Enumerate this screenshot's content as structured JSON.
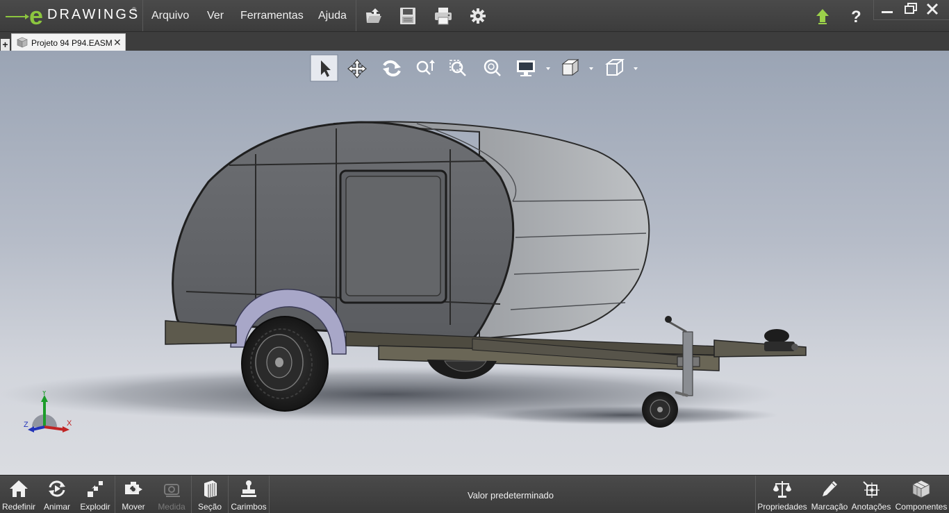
{
  "app": {
    "logo_text": "DRAWINGS",
    "logo_reg": "®"
  },
  "menu": {
    "items": [
      "Arquivo",
      "Ver",
      "Ferramentas",
      "Ajuda"
    ]
  },
  "toolbar": {
    "icons": [
      "open-folder-icon",
      "save-icon",
      "print-icon",
      "settings-gear-icon"
    ]
  },
  "titlebar": {
    "icons": [
      "update-arrow-icon",
      "help-icon",
      "minimize-icon",
      "restore-icon",
      "close-icon"
    ]
  },
  "tabs": {
    "new_tab": "+",
    "active": {
      "label": "Projeto 94 P94.EASM",
      "close": "✕"
    }
  },
  "view_toolbar": {
    "icons": [
      "select-arrow-icon",
      "pan-icon",
      "rotate-icon",
      "zoom-fit-icon",
      "zoom-area-icon",
      "zoom-icon",
      "display-style-icon",
      "view-orientation-icon",
      "cube-view-icon"
    ]
  },
  "triad": {
    "x": "X",
    "y": "Y",
    "z": "Z"
  },
  "bottom": {
    "left_buttons": [
      {
        "label": "Redefinir",
        "icon": "home-icon",
        "enabled": true
      },
      {
        "label": "Animar",
        "icon": "animate-icon",
        "enabled": true
      },
      {
        "label": "Explodir",
        "icon": "explode-icon",
        "enabled": true
      },
      {
        "label": "Mover",
        "icon": "move-icon",
        "enabled": true
      },
      {
        "label": "Medida",
        "icon": "measure-icon",
        "enabled": false
      },
      {
        "label": "Seção",
        "icon": "section-icon",
        "enabled": true
      },
      {
        "label": "Carimbos",
        "icon": "stamp-icon",
        "enabled": true
      }
    ],
    "status": "Valor predeterminado",
    "right_buttons": [
      {
        "label": "Propriedades",
        "icon": "scales-icon"
      },
      {
        "label": "Marcação",
        "icon": "pencil-icon"
      },
      {
        "label": "Anotações",
        "icon": "annotation-icon"
      },
      {
        "label": "Componentes",
        "icon": "components-icon"
      }
    ]
  },
  "colors": {
    "accent": "#8cc63f",
    "bar": "#3f3f3f",
    "viewport_top": "#9aa4b4",
    "viewport_bottom": "#dadce1"
  }
}
